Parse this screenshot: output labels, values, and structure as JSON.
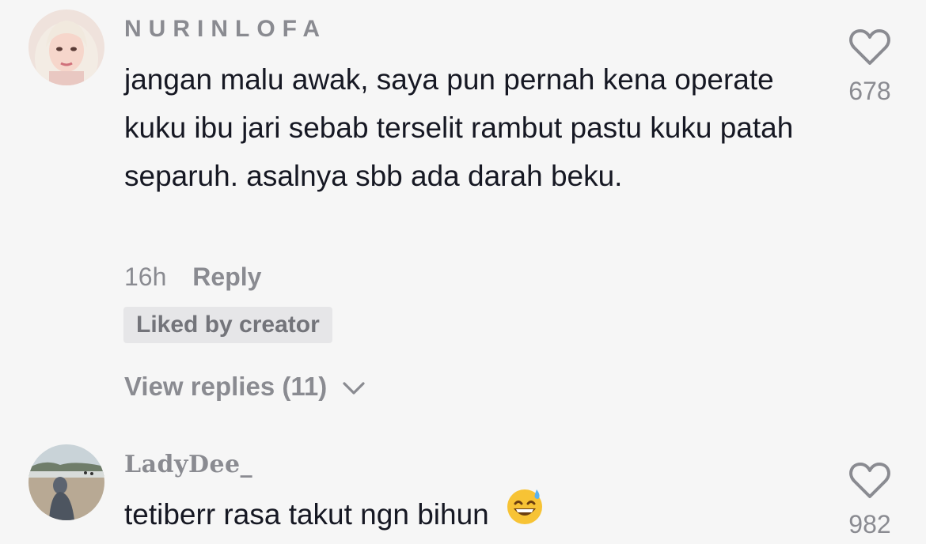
{
  "comments": [
    {
      "username": "NURINLOFA",
      "text": "jangan malu awak, saya pun pernah kena operate kuku ibu jari sebab terselit rambut pastu kuku patah separuh. asalnya sbb ada darah beku.",
      "time": "16h",
      "reply_label": "Reply",
      "badge": "Liked by creator",
      "view_replies": "View replies (11)",
      "likes": "678",
      "avatar_icon": "avatar-blonde-girl"
    },
    {
      "username": "LadyDee_",
      "text": "tetiberr rasa takut ngn bihun",
      "emoji": "grinning-face-with-sweat-emoji",
      "likes": "982",
      "avatar_icon": "avatar-beach-photo"
    }
  ],
  "colors": {
    "background": "#f6f6f6",
    "text": "#161823",
    "muted": "#8a8b91",
    "badge_bg": "#e6e6e8"
  }
}
